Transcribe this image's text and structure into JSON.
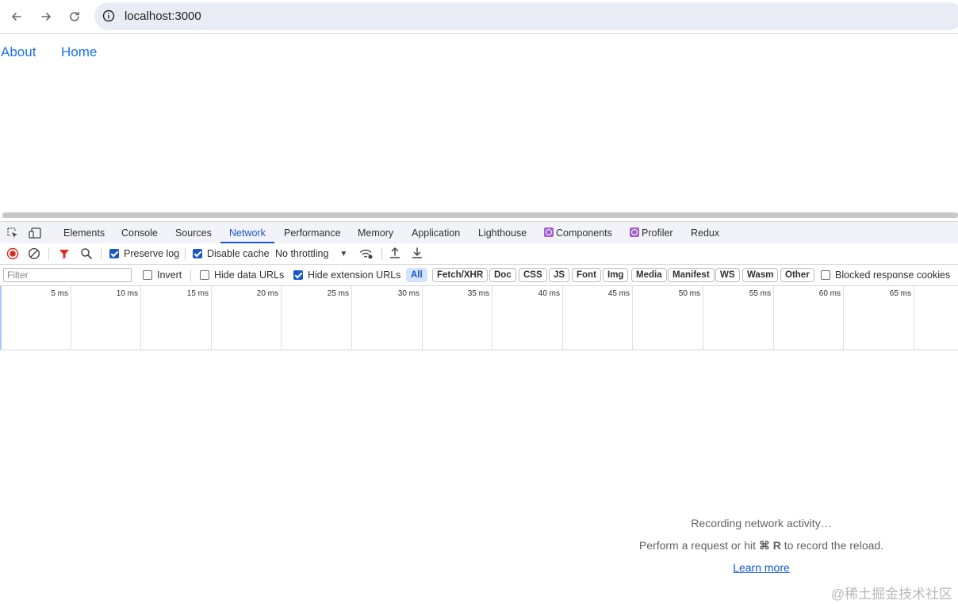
{
  "browser": {
    "url": "localhost:3000"
  },
  "page": {
    "links": [
      "About",
      "Home"
    ]
  },
  "devtools": {
    "tabs": [
      "Elements",
      "Console",
      "Sources",
      "Network",
      "Performance",
      "Memory",
      "Application",
      "Lighthouse",
      "Components",
      "Profiler",
      "Redux"
    ],
    "active_tab": "Network",
    "toolbar": {
      "preserve_log": "Preserve log",
      "preserve_log_checked": true,
      "disable_cache": "Disable cache",
      "disable_cache_checked": true,
      "throttling": "No throttling"
    },
    "filter": {
      "placeholder": "Filter",
      "invert": "Invert",
      "hide_data_urls": "Hide data URLs",
      "hide_extension_urls": "Hide extension URLs",
      "hide_extension_urls_checked": true,
      "types": [
        "All",
        "Fetch/XHR",
        "Doc",
        "CSS",
        "JS",
        "Font",
        "Img",
        "Media",
        "Manifest",
        "WS",
        "Wasm",
        "Other"
      ],
      "active_type": "All",
      "blocked_cookies": "Blocked response cookies"
    },
    "timeline_ticks": [
      "5 ms",
      "10 ms",
      "15 ms",
      "20 ms",
      "25 ms",
      "30 ms",
      "35 ms",
      "40 ms",
      "45 ms",
      "50 ms",
      "55 ms",
      "60 ms",
      "65 ms"
    ],
    "empty_state": {
      "line1": "Recording network activity…",
      "line2_prefix": "Perform a request or hit",
      "line2_key": "⌘ R",
      "line2_suffix": "to record the reload.",
      "link": "Learn more"
    }
  },
  "watermark": "@稀土掘金技术社区",
  "colors": {
    "accent": "#1a57c8",
    "link": "#1a73e8",
    "record": "#d93025"
  }
}
